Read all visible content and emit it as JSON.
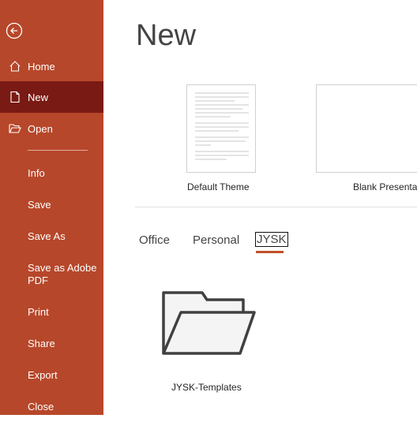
{
  "sidebar": {
    "back_icon": "back-arrow-circle-icon",
    "items": [
      {
        "label": "Home",
        "icon": "home-icon"
      },
      {
        "label": "New",
        "icon": "new-document-icon"
      },
      {
        "label": "Open",
        "icon": "open-folder-icon"
      },
      {
        "label": "Info"
      },
      {
        "label": "Save"
      },
      {
        "label": "Save As"
      },
      {
        "label": "Save as Adobe PDF"
      },
      {
        "label": "Print"
      },
      {
        "label": "Share"
      },
      {
        "label": "Export"
      },
      {
        "label": "Close"
      }
    ],
    "active": "New"
  },
  "main": {
    "title": "New",
    "templates": [
      {
        "label": "Default Theme"
      },
      {
        "label": "Blank Presentation"
      }
    ],
    "tabs": [
      {
        "label": "Office"
      },
      {
        "label": "Personal"
      },
      {
        "label": "JYSK"
      }
    ],
    "active_tab": "JYSK",
    "folders": [
      {
        "label": "JYSK-Templates",
        "icon": "folder-icon"
      }
    ]
  },
  "colors": {
    "sidebar": "#b7472a",
    "sidebar_active": "#7a1a14",
    "tab_underline": "#c0502b"
  }
}
